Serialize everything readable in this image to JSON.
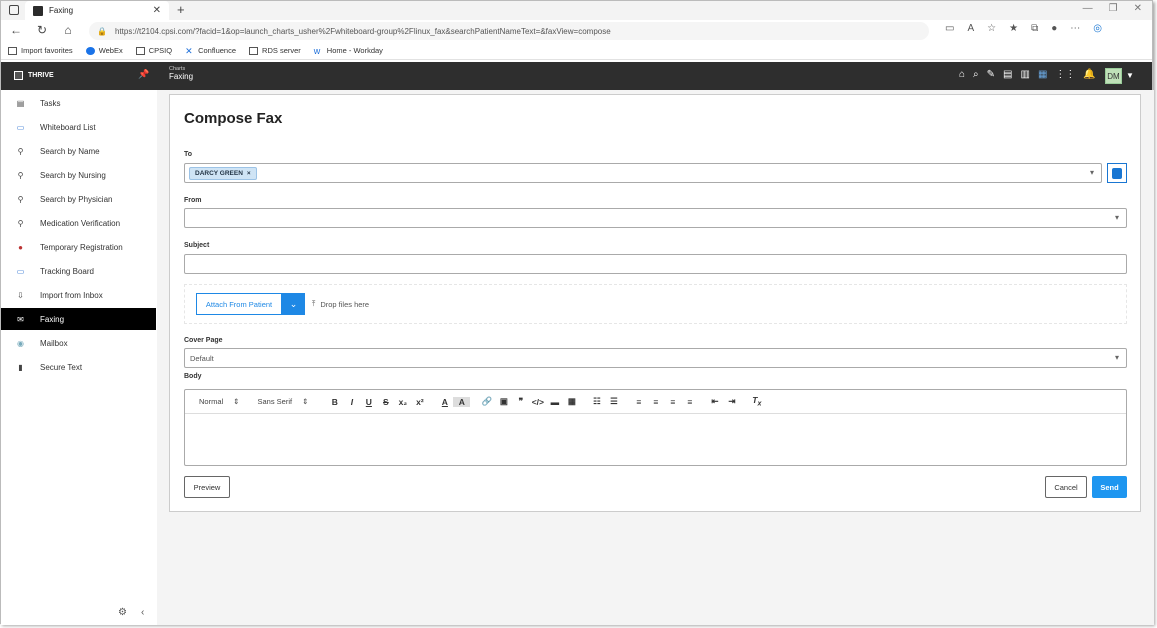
{
  "browser": {
    "tab_title": "Faxing",
    "url": "https://t2104.cpsi.com/?facid=1&op=launch_charts_usher%2Fwhiteboard-group%2Flinux_fax&searchPatientNameText=&faxView=compose",
    "bookmarks": [
      "Import favorites",
      "WebEx",
      "CPSIQ",
      "Confluence",
      "RDS server",
      "Home - Workday"
    ]
  },
  "app": {
    "logo_text": "THRIVE",
    "breadcrumb_parent": "Charts",
    "breadcrumb_current": "Faxing",
    "user_initials": "DM"
  },
  "sidebar": {
    "items": [
      {
        "label": "Tasks",
        "icon": "clipboard-icon"
      },
      {
        "label": "Whiteboard List",
        "icon": "whiteboard-icon"
      },
      {
        "label": "Search by Name",
        "icon": "patient-search-icon"
      },
      {
        "label": "Search by Nursing",
        "icon": "nurse-search-icon"
      },
      {
        "label": "Search by Physician",
        "icon": "physician-search-icon"
      },
      {
        "label": "Medication Verification",
        "icon": "medication-icon"
      },
      {
        "label": "Temporary Registration",
        "icon": "registration-icon"
      },
      {
        "label": "Tracking Board",
        "icon": "tracking-board-icon"
      },
      {
        "label": "Import from Inbox",
        "icon": "import-icon"
      },
      {
        "label": "Faxing",
        "icon": "fax-icon"
      },
      {
        "label": "Mailbox",
        "icon": "mailbox-icon"
      },
      {
        "label": "Secure Text",
        "icon": "phone-icon"
      }
    ],
    "active_index": 9
  },
  "compose": {
    "title": "Compose Fax",
    "to_label": "To",
    "to_recipient": "DARCY GREEN",
    "from_label": "From",
    "from_value": "",
    "subject_label": "Subject",
    "subject_value": "",
    "attach_button": "Attach From Patient",
    "drop_text": "Drop files here",
    "cover_label": "Cover Page",
    "cover_value": "Default",
    "body_label": "Body",
    "font_size_select": "Normal",
    "font_family_select": "Sans Serif",
    "preview_button": "Preview",
    "cancel_button": "Cancel",
    "send_button": "Send"
  },
  "colors": {
    "accent": "#1e96f0",
    "appbar": "#2e2e2e",
    "chip_bg": "#cfe4f5",
    "active_nav": "#000000"
  }
}
